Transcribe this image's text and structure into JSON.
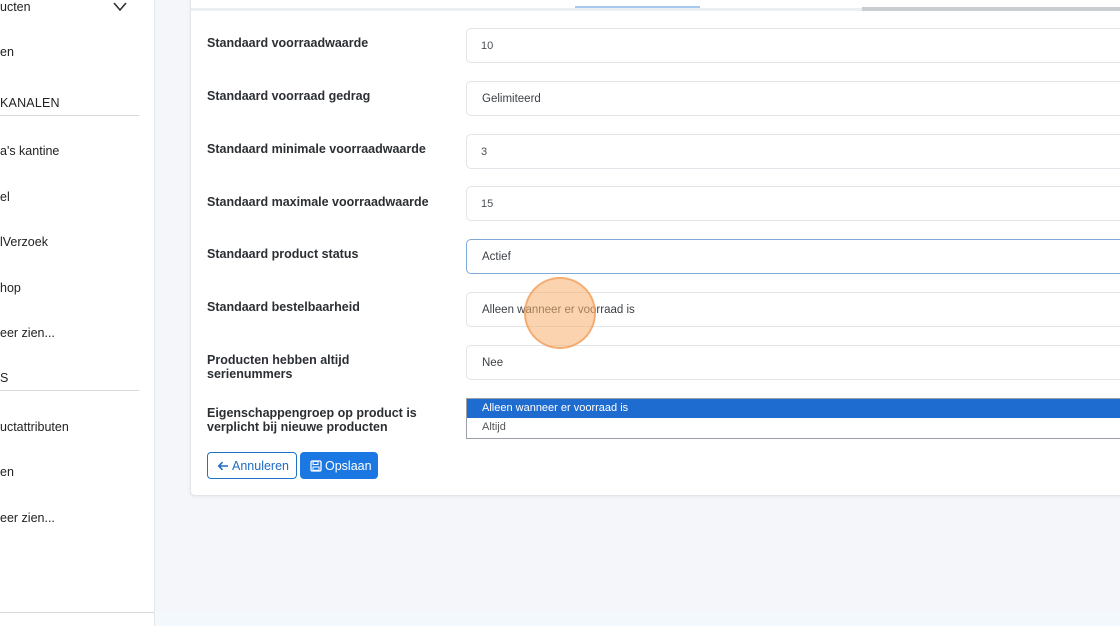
{
  "sidebar": {
    "items": [
      {
        "label": "ucten"
      },
      {
        "label": "en"
      },
      {
        "label": "KANALEN"
      },
      {
        "label": "a's kantine"
      },
      {
        "label": "el"
      },
      {
        "label": "lVerzoek"
      },
      {
        "label": "hop"
      },
      {
        "label": "eer zien..."
      },
      {
        "label": "S"
      },
      {
        "label": "uctattributen"
      },
      {
        "label": "en"
      },
      {
        "label": "eer zien..."
      }
    ]
  },
  "form": {
    "rows": [
      {
        "label": "Standaard voorraadwaarde",
        "value": "10"
      },
      {
        "label": "Standaard voorraad gedrag",
        "value": "Gelimiteerd"
      },
      {
        "label": "Standaard minimale voorraadwaarde",
        "value": "3"
      },
      {
        "label": "Standaard maximale voorraadwaarde",
        "value": "15"
      },
      {
        "label": "Standaard product status",
        "value": "Actief"
      },
      {
        "label": "Standaard bestelbaarheid",
        "value": "Alleen wanneer er voorraad is"
      },
      {
        "label": "Producten hebben altijd serienummers",
        "value": "Nee"
      },
      {
        "label": "Eigenschappengroep op product is verplicht bij nieuwe producten"
      }
    ],
    "dropdown_options": [
      "Alleen wanneer er voorraad is",
      "Altijd"
    ]
  },
  "buttons": {
    "cancel_label": "Annuleren",
    "save_label": "Opslaan"
  },
  "colors": {
    "primary": "#1b78e2",
    "dropdown_highlight": "#1f6cd1"
  }
}
